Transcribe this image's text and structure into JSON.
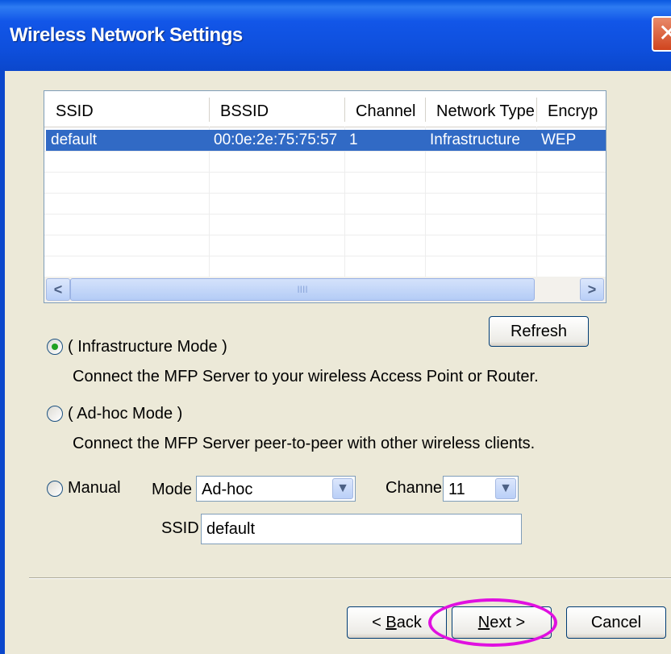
{
  "window": {
    "title": "Wireless Network Settings",
    "close_glyph": "✕"
  },
  "network_list": {
    "columns": [
      "SSID",
      "BSSID",
      "Channel",
      "Network Type",
      "Encryp"
    ],
    "rows": [
      {
        "ssid": "default",
        "bssid": "00:0e:2e:75:75:57",
        "channel": "1",
        "network_type": "Infrastructure",
        "encryption": "WEP",
        "selected": true
      }
    ],
    "scroll_left_glyph": "<",
    "scroll_right_glyph": ">",
    "scroll_thumb_grip": "IIII"
  },
  "refresh_label": "Refresh",
  "modes": {
    "infrastructure": {
      "label": "( Infrastructure Mode )",
      "description": "Connect the MFP Server to your wireless Access Point or Router.",
      "checked": true
    },
    "adhoc": {
      "label": "( Ad-hoc Mode )",
      "description": "Connect the MFP Server peer-to-peer with other wireless clients.",
      "checked": false
    },
    "manual": {
      "label": "Manual",
      "checked": false,
      "mode_label": "Mode",
      "mode_value": "Ad-hoc",
      "channel_label": "Channel",
      "channel_value": "11",
      "ssid_label": "SSID",
      "ssid_value": "default"
    }
  },
  "footer": {
    "back_prefix": "< ",
    "back_key": "B",
    "back_rest": "ack",
    "next_key": "N",
    "next_rest": "ext",
    "next_suffix": " >",
    "cancel_label": "Cancel"
  },
  "colors": {
    "titlebar": "#0B47CC",
    "selection": "#316AC5",
    "highlight_ellipse": "#E010E0",
    "dialog_bg": "#ECE9D8"
  },
  "icons": {
    "dropdown": "chevron-down-icon",
    "radio_checked": "radio-checked-icon",
    "close": "close-icon"
  }
}
